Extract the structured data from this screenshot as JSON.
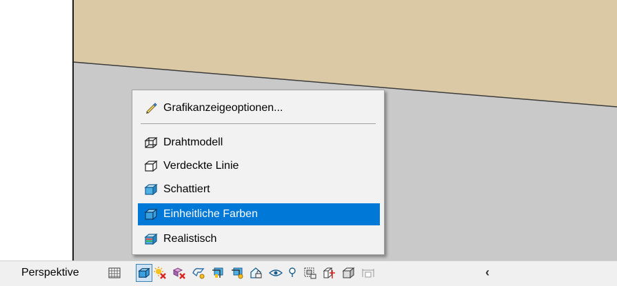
{
  "view": {
    "colors": {
      "floor": "#dbc9a5",
      "wall": "#c9c9c9",
      "edge": "#1a1a1a"
    }
  },
  "menu": {
    "top_item": {
      "label": "Grafikanzeigeoptionen...",
      "icon": "pencil-icon"
    },
    "items": [
      {
        "label": "Drahtmodell",
        "icon": "wireframe-cube-icon",
        "selected": false
      },
      {
        "label": "Verdeckte Linie",
        "icon": "hidden-line-cube-icon",
        "selected": false
      },
      {
        "label": "Schattiert",
        "icon": "shaded-cube-icon",
        "selected": false
      },
      {
        "label": "Einheitliche Farben",
        "icon": "consistent-colors-cube-icon",
        "selected": true
      },
      {
        "label": "Realistisch",
        "icon": "realistic-cube-icon",
        "selected": false
      }
    ],
    "colors": {
      "selected_bg": "#0078d7",
      "selected_text": "#ffffff"
    }
  },
  "statusbar": {
    "projection_label": "Perspektive",
    "buttons": [
      "detail-level-icon",
      "visual-style-icon",
      "sun-path-off-icon",
      "shadows-off-icon",
      "render-icon",
      "crop-view-icon",
      "show-crop-region-icon",
      "unlock-3d-view-icon",
      "temporary-hide-isolate-icon",
      "reveal-hidden-elements-icon",
      "temporary-view-properties-icon",
      "show-analytical-model-icon",
      "highlight-displacement-sets-icon",
      "reveal-constraints-icon"
    ],
    "more": "‹"
  }
}
